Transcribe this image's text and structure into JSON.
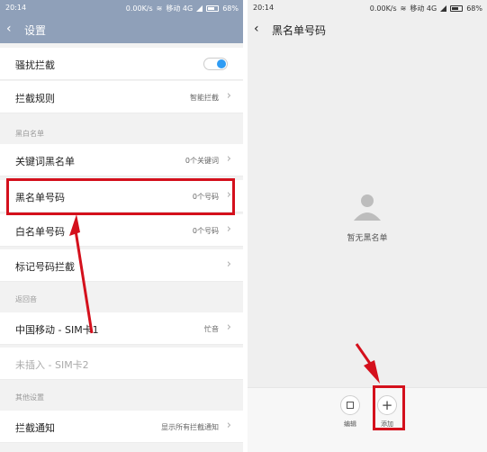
{
  "left": {
    "status": {
      "time": "20:14",
      "speed": "0.00K/s",
      "carrier": "移动 4G",
      "battery": "68%"
    },
    "title": "设置",
    "rows": [
      {
        "label": "骚扰拦截",
        "value": ""
      },
      {
        "label": "拦截规则",
        "value": "智能拦截"
      },
      {
        "label": "黑白名单",
        "value": ""
      },
      {
        "label": "关键词黑名单",
        "value": "0个关键词"
      },
      {
        "label": "黑名单号码",
        "value": "0个号码"
      },
      {
        "label": "白名单号码",
        "value": "0个号码"
      },
      {
        "label": "标记号码拦截",
        "value": ""
      },
      {
        "label": "返回音",
        "value": ""
      },
      {
        "label": "中国移动 - SIM卡1",
        "value": "忙音"
      },
      {
        "label": "未插入 - SIM卡2",
        "value": ""
      },
      {
        "label": "其他设置",
        "value": ""
      },
      {
        "label": "拦截通知",
        "value": "显示所有拦截通知"
      }
    ]
  },
  "right": {
    "status": {
      "time": "20:14",
      "speed": "0.00K/s",
      "carrier": "移动 4G",
      "battery": "68%"
    },
    "title": "黑名单号码",
    "empty_text": "暂无黑名单",
    "actions": [
      {
        "label": "编辑",
        "icon": "edit-icon"
      },
      {
        "label": "添加",
        "icon": "plus-icon"
      }
    ]
  },
  "colors": {
    "accent": "#2f9cf4",
    "highlight": "#d4101c",
    "titlebar": "#8fa0b9"
  }
}
